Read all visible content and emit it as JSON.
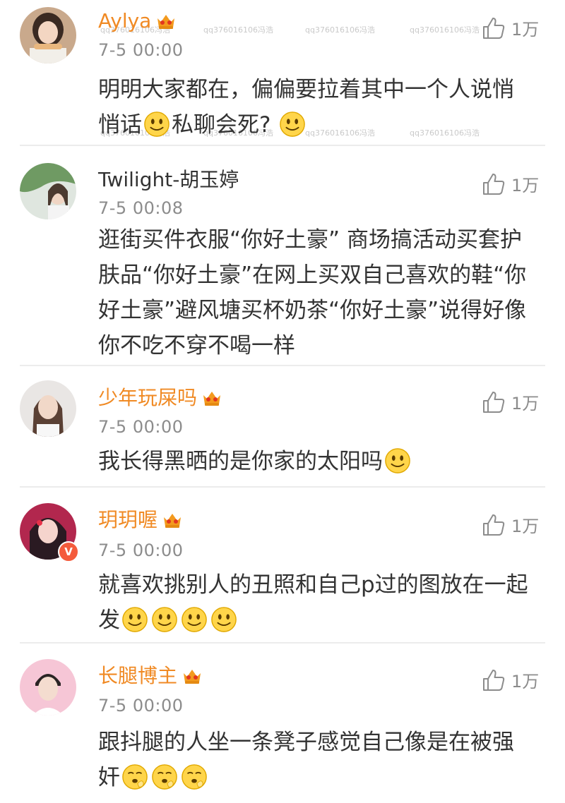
{
  "watermark": "qq376016106冯浩",
  "comments": [
    {
      "username": "Aylya",
      "time": "7-5 00:00",
      "likes": "1万",
      "text": [
        "明明大家都在，偏偏要拉着其中一个人说悄",
        "悄话",
        "私聊会死?"
      ],
      "avatar_icon": "avatar-girl-eating-icon",
      "badge_icon": "crown-badge-icon"
    },
    {
      "username": "Twilight-胡玉婷",
      "time": "7-5 00:08",
      "likes": "1万",
      "text": [
        "逛街买件衣服“你好土豪” 商场搞活动买套护",
        "肤品“你好土豪”在网上买双自己喜欢的鞋“你",
        "好土豪”避风塘买杯奶茶“你好土豪”说得好像",
        "你不吃不穿不喝一样"
      ],
      "avatar_icon": "avatar-girl-plants-icon"
    },
    {
      "username": "少年玩屎吗",
      "time": "7-5 00:00",
      "likes": "1万",
      "text": [
        "我长得黑晒的是你家的太阳吗"
      ],
      "avatar_icon": "avatar-girl-portrait-icon",
      "badge_icon": "crown-badge-icon"
    },
    {
      "username": "玥玥喔",
      "time": "7-5 00:00",
      "likes": "1万",
      "text": [
        "就喜欢挑别人的丑照和自己p过的图放在一起",
        "发"
      ],
      "avatar_icon": "avatar-girl-red-icon",
      "verified_label": "V",
      "badge_icon": "crown-badge-icon"
    },
    {
      "username": "长腿博主",
      "time": "7-5 00:00",
      "likes": "1万",
      "text": [
        "跟抖腿的人坐一条凳子感觉自己像是在被强",
        "奸"
      ],
      "avatar_icon": "avatar-boy-pink-icon",
      "badge_icon": "crown-badge-icon"
    }
  ],
  "colors": {
    "username_vip": "#f08a24",
    "username_plain": "#333333",
    "meta": "#8c8c8c",
    "divider": "#ececec",
    "verified": "#f45b3c"
  }
}
